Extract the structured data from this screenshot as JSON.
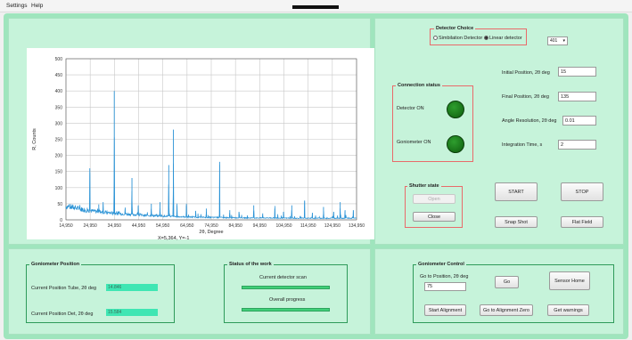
{
  "menu": {
    "settings": "Settings",
    "help": "Help"
  },
  "chart_data": {
    "type": "line",
    "xlabel": "2θ, Degree",
    "ylabel": "R, Counts",
    "xlim": [
      14.95,
      134.95
    ],
    "ylim": [
      0,
      500
    ],
    "xticks": [
      "14,950",
      "24,950",
      "34,950",
      "44,950",
      "54,950",
      "64,950",
      "74,950",
      "84,950",
      "94,950",
      "104,950",
      "114,950",
      "124,950",
      "134,950"
    ],
    "yticks": [
      "0",
      "50",
      "100",
      "150",
      "200",
      "250",
      "300",
      "350",
      "400",
      "450",
      "500"
    ],
    "grid": true,
    "baseline": [
      [
        14.95,
        42
      ],
      [
        18,
        38
      ],
      [
        22,
        32
      ],
      [
        26,
        27
      ],
      [
        30,
        24
      ],
      [
        35,
        20
      ],
      [
        40,
        18
      ],
      [
        45,
        15
      ],
      [
        50,
        13
      ],
      [
        55,
        12
      ],
      [
        60,
        10
      ],
      [
        65,
        9
      ],
      [
        70,
        8
      ],
      [
        80,
        7
      ],
      [
        90,
        6
      ],
      [
        100,
        6
      ],
      [
        110,
        5
      ],
      [
        120,
        5
      ],
      [
        134.95,
        5
      ]
    ],
    "peaks": [
      [
        24.8,
        160
      ],
      [
        28.5,
        48
      ],
      [
        30.3,
        55
      ],
      [
        34.9,
        400
      ],
      [
        39.4,
        38
      ],
      [
        42.2,
        130
      ],
      [
        44.8,
        45
      ],
      [
        50.2,
        50
      ],
      [
        53.8,
        55
      ],
      [
        57.4,
        170
      ],
      [
        59.3,
        280
      ],
      [
        60.8,
        45
      ],
      [
        64.7,
        45
      ],
      [
        68.5,
        28
      ],
      [
        72.9,
        35
      ],
      [
        78.4,
        180
      ],
      [
        82.6,
        30
      ],
      [
        86.4,
        25
      ],
      [
        92.5,
        45
      ],
      [
        96.2,
        20
      ],
      [
        101.2,
        35
      ],
      [
        104.8,
        25
      ],
      [
        108.2,
        45
      ],
      [
        113.5,
        60
      ],
      [
        116.7,
        22
      ],
      [
        121.3,
        40
      ],
      [
        125.5,
        25
      ],
      [
        128.2,
        55
      ],
      [
        130.2,
        30
      ],
      [
        133.6,
        30
      ]
    ]
  },
  "cursor_readout": "X=5,364, Y=-1",
  "detector_choice": {
    "title": "Detector Choice",
    "option1": "Simbilation Detector",
    "option2": "Linear detector",
    "selected": "Linear detector",
    "select_value": "401"
  },
  "connection": {
    "title": "Connection status",
    "detector": "Detector ON",
    "goniometer": "Goniometer ON"
  },
  "params": {
    "initial_label": "Initial Position, 2θ deg",
    "initial_value": "15",
    "final_label": "Final Position, 2θ deg",
    "final_value": "135",
    "resolution_label": "Angle Resolution, 2θ deg",
    "resolution_value": "0.01",
    "integration_label": "Integration Time, s",
    "integration_value": "2"
  },
  "shutter": {
    "title": "Shutter state",
    "open": "Open",
    "close": "Close"
  },
  "actions": {
    "start": "START",
    "stop": "STOP",
    "snapshot": "Snap Shot",
    "flatfield": "Flat Field"
  },
  "gonio_position": {
    "title": "Goniometer Position",
    "tube_label": "Current Position Tube, 2θ deg",
    "tube_value": "14.846",
    "det_label": "Current Position Det, 2θ deg",
    "det_value": "15.584"
  },
  "status": {
    "title": "Status of the work",
    "scan": "Current detector scan",
    "overall": "Overall progress",
    "scan_progress": 1.0,
    "overall_progress": 1.0
  },
  "gonio_control": {
    "title": "Goniometer Control",
    "goto_label": "Go to Position, 2θ deg",
    "goto_value": "75",
    "go": "Go",
    "sensor_home": "Sensor Home",
    "start_alignment": "Start Alignment",
    "goto_zero": "Go to Alignment Zero",
    "get_warnings": "Get warnings"
  },
  "colors": {
    "app_bg": "#9fe5bd",
    "panel_bg": "#c6f3da",
    "spectrum": "#2b93d6",
    "led": "#138a13",
    "group_border": "#e96a6a"
  }
}
